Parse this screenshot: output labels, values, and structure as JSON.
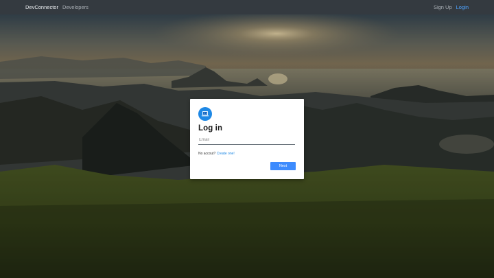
{
  "navbar": {
    "brand": "DevConnector",
    "developers_link": "Developers",
    "signup_link": "Sign Up",
    "login_link": "Login"
  },
  "login_card": {
    "title": "Log in",
    "email_placeholder": "Email",
    "no_account_text": "No accout?",
    "create_link": "Create one!",
    "next_button": "Next"
  },
  "colors": {
    "navbar_bg": "#343a40",
    "accent": "#3d8bfd",
    "link": "#1e88e5"
  },
  "icons": {
    "logo": "laptop-code-icon"
  }
}
